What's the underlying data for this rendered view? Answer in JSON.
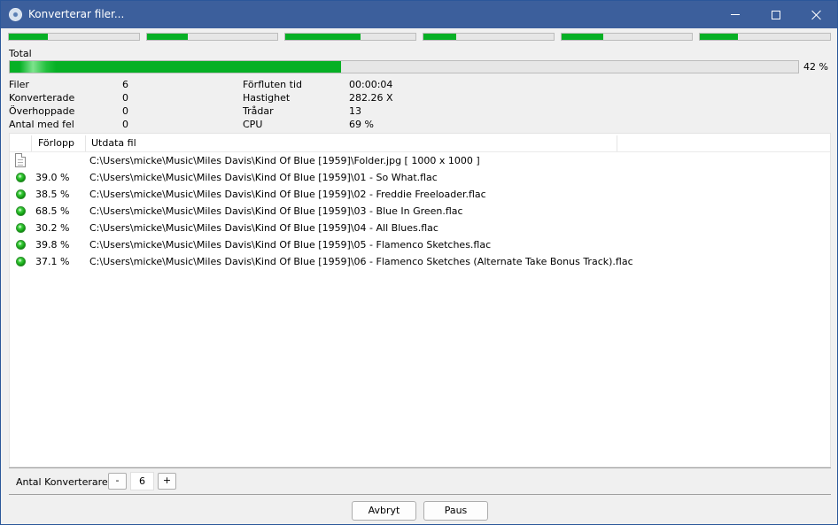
{
  "window": {
    "title": "Konverterar filer...",
    "accent": "#3c5f9c"
  },
  "threads": [
    {
      "progress": 0.3
    },
    {
      "progress": 0.31
    },
    {
      "progress": 0.58
    },
    {
      "progress": 0.25
    },
    {
      "progress": 0.32
    },
    {
      "progress": 0.29
    }
  ],
  "total": {
    "label": "Total",
    "progress": 0.42,
    "percent_text": "42 %",
    "bar_color": "#06b025"
  },
  "stats": {
    "files_label": "Filer",
    "files_value": "6",
    "converted_label": "Konverterade",
    "converted_value": "0",
    "skipped_label": "Överhoppade",
    "skipped_value": "0",
    "errors_label": "Antal med fel",
    "errors_value": "0",
    "elapsed_label": "Förfluten tid",
    "elapsed_value": "00:00:04",
    "speed_label": "Hastighet",
    "speed_value": "282.26 X",
    "threads_label": "Trådar",
    "threads_value": "13",
    "cpu_label": "CPU",
    "cpu_value": "69 %"
  },
  "list": {
    "col_progress": "Förlopp",
    "col_output": "Utdata fil",
    "rows": [
      {
        "icon": "document-icon",
        "pct": "",
        "path": "C:\\Users\\micke\\Music\\Miles Davis\\Kind Of Blue [1959]\\Folder.jpg [ 1000 x 1000 ]"
      },
      {
        "icon": "green-status-icon",
        "pct": "39.0 %",
        "path": "C:\\Users\\micke\\Music\\Miles Davis\\Kind Of Blue [1959]\\01 - So What.flac"
      },
      {
        "icon": "green-status-icon",
        "pct": "38.5 %",
        "path": "C:\\Users\\micke\\Music\\Miles Davis\\Kind Of Blue [1959]\\02 - Freddie Freeloader.flac"
      },
      {
        "icon": "green-status-icon",
        "pct": "68.5 %",
        "path": "C:\\Users\\micke\\Music\\Miles Davis\\Kind Of Blue [1959]\\03 - Blue In Green.flac"
      },
      {
        "icon": "green-status-icon",
        "pct": "30.2 %",
        "path": "C:\\Users\\micke\\Music\\Miles Davis\\Kind Of Blue [1959]\\04 - All Blues.flac"
      },
      {
        "icon": "green-status-icon",
        "pct": "39.8 %",
        "path": "C:\\Users\\micke\\Music\\Miles Davis\\Kind Of Blue [1959]\\05 - Flamenco Sketches.flac"
      },
      {
        "icon": "green-status-icon",
        "pct": "37.1 %",
        "path": "C:\\Users\\micke\\Music\\Miles Davis\\Kind Of Blue [1959]\\06 - Flamenco Sketches (Alternate Take Bonus Track).flac"
      }
    ]
  },
  "converters": {
    "label": "Antal Konverterare:",
    "minus": "-",
    "value": "6",
    "plus": "+"
  },
  "buttons": {
    "cancel": "Avbryt",
    "pause": "Paus"
  }
}
